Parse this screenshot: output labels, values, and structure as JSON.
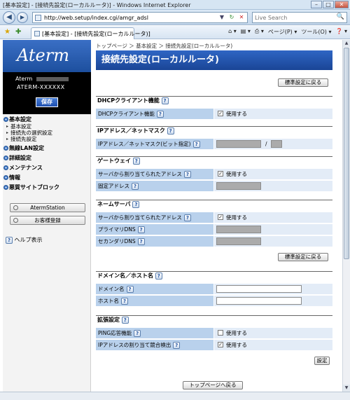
{
  "window": {
    "title": "[基本設定] - [接続先設定(ローカルルータ)] - Windows Internet Explorer",
    "min": "–",
    "max": "□",
    "close": "✕"
  },
  "address": {
    "back": "◀",
    "forward": "▶",
    "url": "http://web.setup/index.cgi/amgr_adsl",
    "go": "▼",
    "refresh": "↻",
    "stop": "✕",
    "search_placeholder": "Live Search",
    "search_icon": "🔍"
  },
  "tabbar": {
    "fav_star": "★",
    "add_fav": "✚",
    "tab_title": "[基本設定] - [接続先設定(ローカルルータ)]",
    "commands": [
      "⌂ ▾",
      "▤ ▾",
      "⎙ ▾",
      "ページ(P) ▾",
      "ツール(O) ▾",
      "❓ ▾"
    ]
  },
  "sidebar": {
    "logo": "Aterm",
    "model_prefix": "Aterm",
    "model_name": "ATERM-XXXXXX",
    "save_label": "保存",
    "menu": [
      {
        "label": "基本設定",
        "subs": [
          "基本設定",
          "接続先の選択設定",
          "接続先設定"
        ]
      },
      {
        "label": "無線LAN設定",
        "subs": []
      },
      {
        "label": "詳細設定",
        "subs": []
      },
      {
        "label": "メンテナンス",
        "subs": []
      },
      {
        "label": "情報",
        "subs": []
      },
      {
        "label": "悪質サイトブロック",
        "subs": []
      }
    ],
    "aterm_station": "AtermStation",
    "customer_reg": "お客様登録",
    "help": "ヘルプ表示"
  },
  "main": {
    "breadcrumb": "トップページ ＞ 基本設定 ＞ 接続先設定(ローカルルータ)",
    "title": "接続先設定(ローカルルータ)",
    "reset_label": "標準設定に戻る",
    "set_label": "設定",
    "top_label": "トップページへ戻る",
    "help_glyph": "?",
    "use_label": "使用する",
    "check_mark": "✓",
    "sections": {
      "dhcp": {
        "title": "DHCPクライアント機能",
        "row1": "DHCPクライアント機能"
      },
      "ipmask": {
        "title": "IPアドレス／ネットマスク",
        "row1": "IPアドレス／ネットマスク(ビット指定)",
        "slash": "/"
      },
      "gateway": {
        "title": "ゲートウェイ",
        "row1": "サーバから割り当てられたアドレス",
        "row2": "固定アドレス"
      },
      "dns": {
        "title": "ネームサーバ",
        "row1": "サーバから割り当てられたアドレス",
        "row2": "プライマリDNS",
        "row3": "セカンダリDNS"
      },
      "domain": {
        "title": "ドメイン名／ホスト名",
        "row1": "ドメイン名",
        "row2": "ホスト名"
      },
      "ext": {
        "title": "拡張設定",
        "row1": "PING応答機能",
        "row2": "IPアドレスの割り当て競合検出"
      }
    },
    "checks": {
      "dhcp": true,
      "gateway": true,
      "dns": true,
      "ping": false,
      "conflict": true
    }
  }
}
